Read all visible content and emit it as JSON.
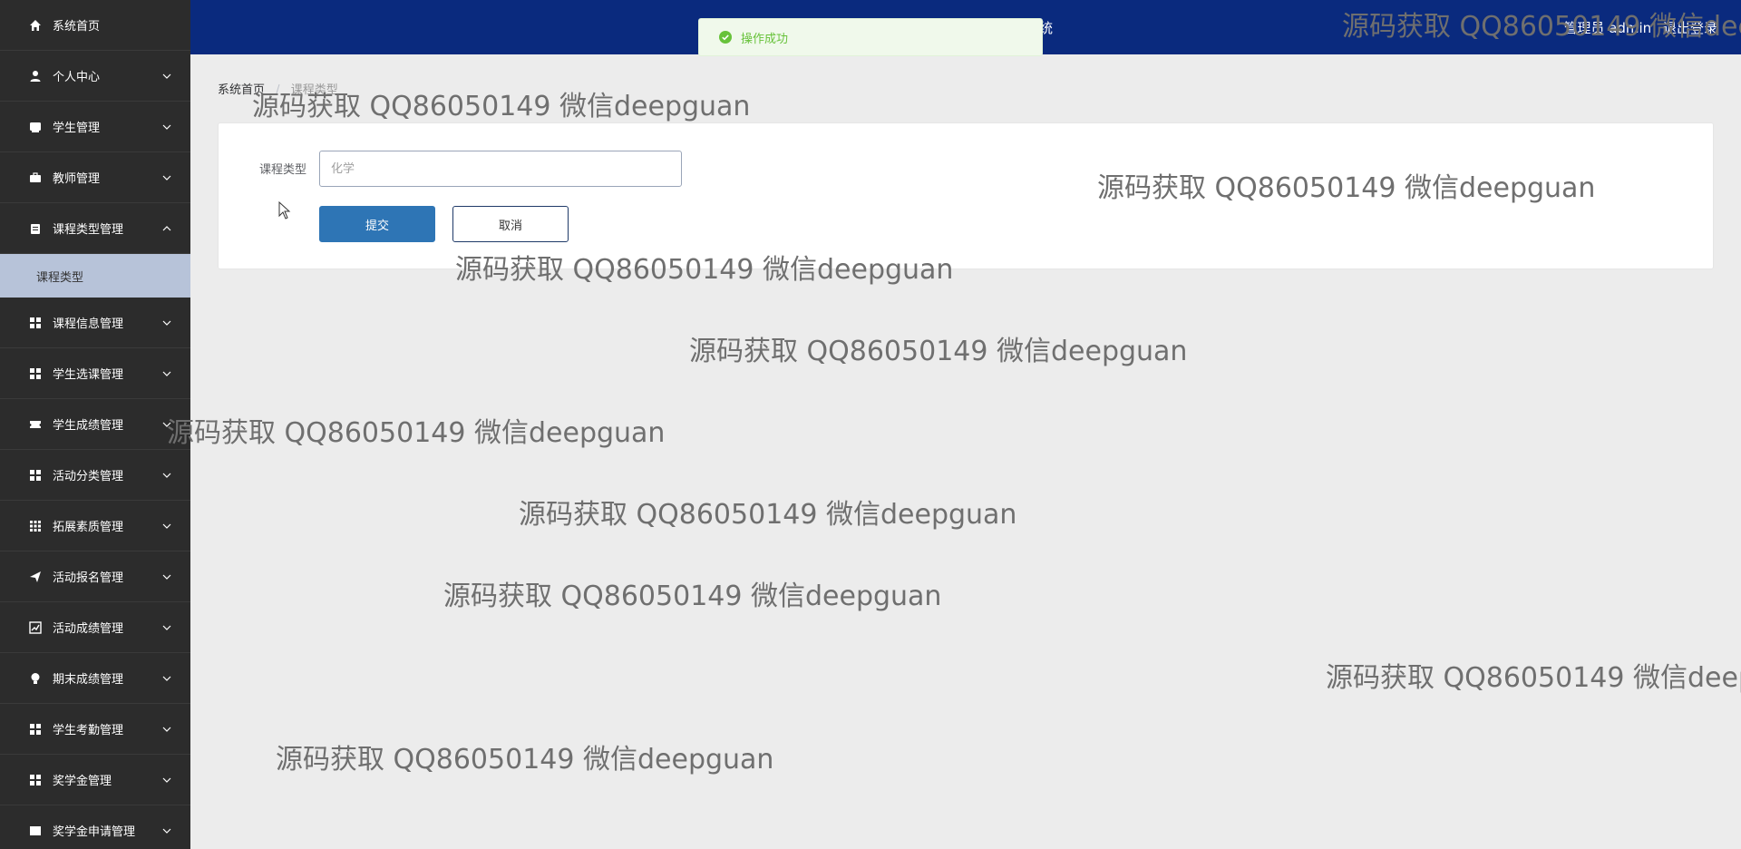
{
  "sidebar": {
    "items": [
      {
        "label": "系统首页",
        "icon": "home-icon",
        "has_children": false
      },
      {
        "label": "个人中心",
        "icon": "user-icon",
        "has_children": true
      },
      {
        "label": "学生管理",
        "icon": "card-icon",
        "has_children": true
      },
      {
        "label": "教师管理",
        "icon": "briefcase-icon",
        "has_children": true
      },
      {
        "label": "课程类型管理",
        "icon": "clipboard-icon",
        "has_children": true,
        "expanded": true
      },
      {
        "label": "课程信息管理",
        "icon": "grid-icon",
        "has_children": true
      },
      {
        "label": "学生选课管理",
        "icon": "grid-icon",
        "has_children": true
      },
      {
        "label": "学生成绩管理",
        "icon": "ticket-icon",
        "has_children": true
      },
      {
        "label": "活动分类管理",
        "icon": "grid-icon",
        "has_children": true
      },
      {
        "label": "拓展素质管理",
        "icon": "apps-icon",
        "has_children": true
      },
      {
        "label": "活动报名管理",
        "icon": "paper-plane-icon",
        "has_children": true
      },
      {
        "label": "活动成绩管理",
        "icon": "chart-icon",
        "has_children": true
      },
      {
        "label": "期末成绩管理",
        "icon": "bulb-icon",
        "has_children": true
      },
      {
        "label": "学生考勤管理",
        "icon": "grid-icon",
        "has_children": true
      },
      {
        "label": "奖学金管理",
        "icon": "grid-icon",
        "has_children": true
      },
      {
        "label": "奖学金申请管理",
        "icon": "square-icon",
        "has_children": true
      }
    ],
    "submenu": {
      "label": "课程类型"
    }
  },
  "header": {
    "title_fragment": "统",
    "user": "管理员 admin",
    "logout": "退出登录"
  },
  "toast": {
    "message": "操作成功"
  },
  "breadcrumb": {
    "home": "系统首页",
    "separator": "/",
    "current": "课程类型"
  },
  "form": {
    "field_label": "课程类型",
    "field_value": "",
    "field_placeholder": "化学",
    "submit_label": "提交",
    "cancel_label": "取消"
  },
  "watermark": {
    "text": "源码获取 QQ86050149 微信deepguan"
  },
  "colors": {
    "sidebar_bg": "#2c2c2c",
    "header_bg": "#0a2a7e",
    "submenu_active_bg": "#b7c3d9",
    "primary_button": "#2e75b5",
    "success_text": "#67c23a"
  }
}
